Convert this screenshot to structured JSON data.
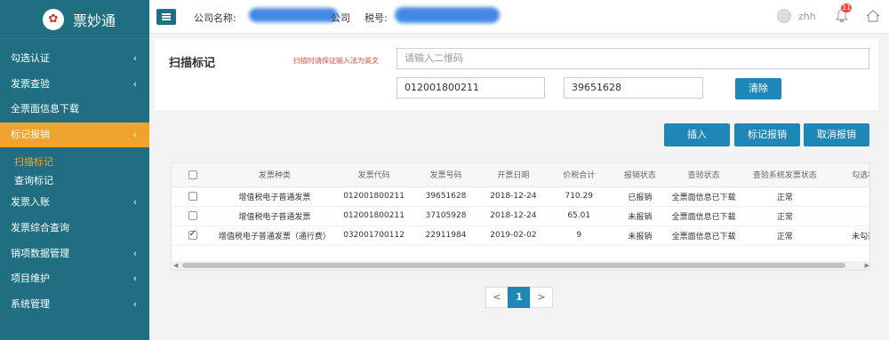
{
  "app": {
    "title": "票妙通",
    "logo_glyph": "✿"
  },
  "sidebar": {
    "items": [
      {
        "label": "勾选认证",
        "chev": "‹"
      },
      {
        "label": "发票查验",
        "chev": "‹"
      },
      {
        "label": "全票面信息下载",
        "chev": ""
      },
      {
        "label": "标记报销",
        "chev": "‹"
      },
      {
        "label": "扫描标记"
      },
      {
        "label": "查询标记"
      },
      {
        "label": "发票入账",
        "chev": "‹"
      },
      {
        "label": "发票综合查询",
        "chev": ""
      },
      {
        "label": "销项数据管理",
        "chev": "‹"
      },
      {
        "label": "项目维护",
        "chev": "‹"
      },
      {
        "label": "系统管理",
        "chev": "‹"
      }
    ]
  },
  "header": {
    "company_label": "公司名称:",
    "company_value_suffix": "公司",
    "tax_label": "税号:",
    "username": "zhh",
    "notification_count": "11"
  },
  "scan": {
    "title": "扫描标记",
    "hint": "扫描时请保证输入法为英文",
    "qr_placeholder": "请输入二维码",
    "invoice_code": "012001800211",
    "invoice_number": "39651628",
    "clear_label": "清除"
  },
  "actions": {
    "insert": "插入",
    "mark": "标记报销",
    "cancel": "取消报销"
  },
  "table": {
    "headers": [
      "发票种类",
      "发票代码",
      "发票号码",
      "开票日期",
      "价税合计",
      "报销状态",
      "查验状态",
      "查验系统发票状态",
      "勾选状"
    ],
    "rows": [
      {
        "checked": false,
        "type": "增值税电子普通发票",
        "code": "012001800211",
        "number": "39651628",
        "date": "2018-12-24",
        "total": "710.29",
        "reimb": "已报销",
        "verify": "全票面信息已下载",
        "sys_status": "正常",
        "check": ""
      },
      {
        "checked": false,
        "type": "增值税电子普通发票",
        "code": "012001800211",
        "number": "37105928",
        "date": "2018-12-24",
        "total": "65.01",
        "reimb": "未报销",
        "verify": "全票面信息已下载",
        "sys_status": "正常",
        "check": ""
      },
      {
        "checked": true,
        "type": "增值税电子普通发票（通行费）",
        "code": "032001700112",
        "number": "22911984",
        "date": "2019-02-02",
        "total": "9",
        "reimb": "未报销",
        "verify": "全票面信息已下载",
        "sys_status": "正常",
        "check": "未勾选"
      }
    ]
  },
  "pagination": {
    "prev": "<",
    "current": "1",
    "next": ">"
  },
  "colors": {
    "sidebar": "#1f6e82",
    "accent": "#f0a32c",
    "primary": "#1f86b8"
  }
}
